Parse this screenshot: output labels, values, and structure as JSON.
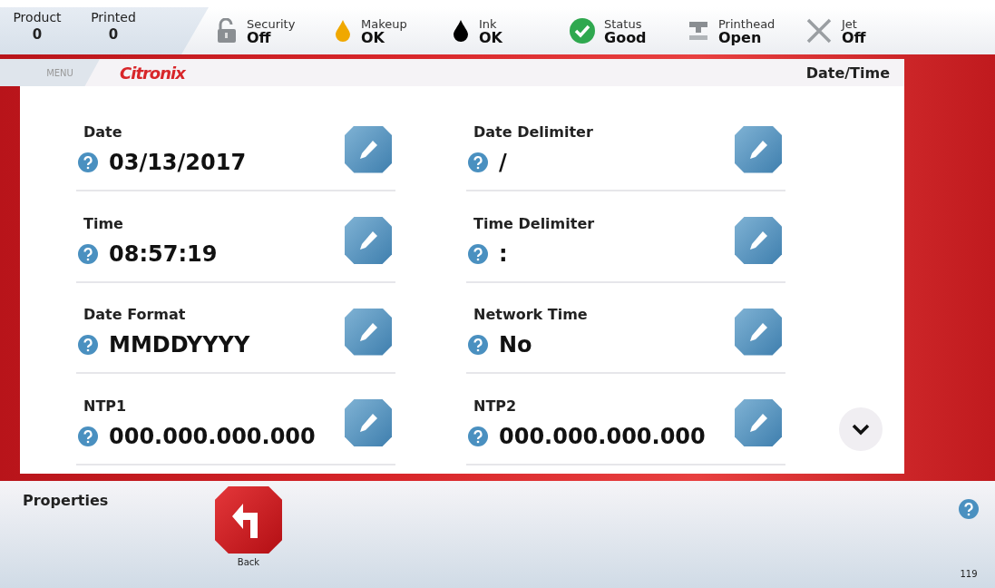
{
  "status_bar": {
    "counters": [
      {
        "label": "Product",
        "value": "0"
      },
      {
        "label": "Printed",
        "value": "0"
      }
    ],
    "indicators": [
      {
        "kind": "lock",
        "label": "Security",
        "value": "Off"
      },
      {
        "kind": "drop-amber",
        "label": "Makeup",
        "value": "OK"
      },
      {
        "kind": "drop-black",
        "label": "Ink",
        "value": "OK"
      },
      {
        "kind": "check",
        "label": "Status",
        "value": "Good"
      },
      {
        "kind": "printhead",
        "label": "Printhead",
        "value": "Open"
      },
      {
        "kind": "cross",
        "label": "Jet",
        "value": "Off"
      }
    ]
  },
  "header": {
    "menu": "MENU",
    "logo": "Citronix",
    "title": "Date/Time"
  },
  "fields": [
    {
      "label": "Date",
      "value": "03/13/2017"
    },
    {
      "label": "Date Delimiter",
      "value": "/"
    },
    {
      "label": "Time",
      "value": "08:57:19"
    },
    {
      "label": "Time Delimiter",
      "value": ":"
    },
    {
      "label": "Date Format",
      "value": "MMDDYYYY"
    },
    {
      "label": "Network Time",
      "value": "No"
    },
    {
      "label": "NTP1",
      "value": "000.000.000.000"
    },
    {
      "label": "NTP2",
      "value": "000.000.000.000"
    }
  ],
  "footer": {
    "title": "Properties",
    "back_button": "Back",
    "page_number": "119"
  }
}
